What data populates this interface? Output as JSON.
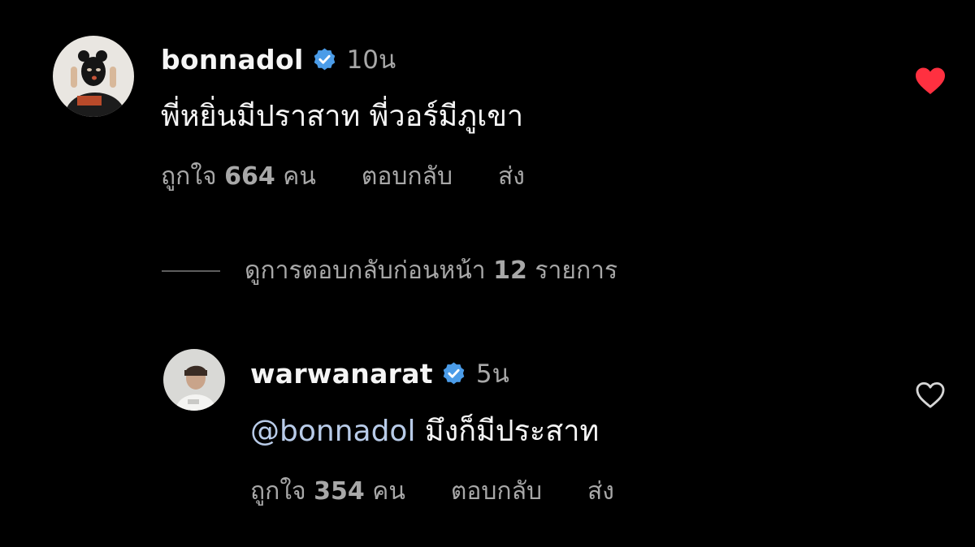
{
  "colors": {
    "background": "#000000",
    "text_primary": "#f5f5f5",
    "text_secondary": "#a8a8a8",
    "verified_blue": "#4b9ce8",
    "like_red": "#ff3040",
    "mention": "#b8cbe8"
  },
  "comments": [
    {
      "username": "bonnadol",
      "verified": true,
      "time": "10น",
      "text": "พี่หยิ่นมีปราสาท พี่วอร์มีภูเขา",
      "likes_prefix": "ถูกใจ",
      "likes_count": "664",
      "likes_suffix": "คน",
      "reply_label": "ตอบกลับ",
      "send_label": "ส่ง",
      "liked": true,
      "like_icon": "heart-filled-icon"
    },
    {
      "username": "warwanarat",
      "verified": true,
      "time": "5น",
      "mention": "@bonnadol",
      "text": "มึงก็มีประสาท",
      "likes_prefix": "ถูกใจ",
      "likes_count": "354",
      "likes_suffix": "คน",
      "reply_label": "ตอบกลับ",
      "send_label": "ส่ง",
      "liked": false,
      "like_icon": "heart-outline-icon"
    }
  ],
  "view_previous_replies": {
    "prefix": "ดูการตอบกลับก่อนหน้า",
    "count": "12",
    "suffix": "รายการ"
  }
}
